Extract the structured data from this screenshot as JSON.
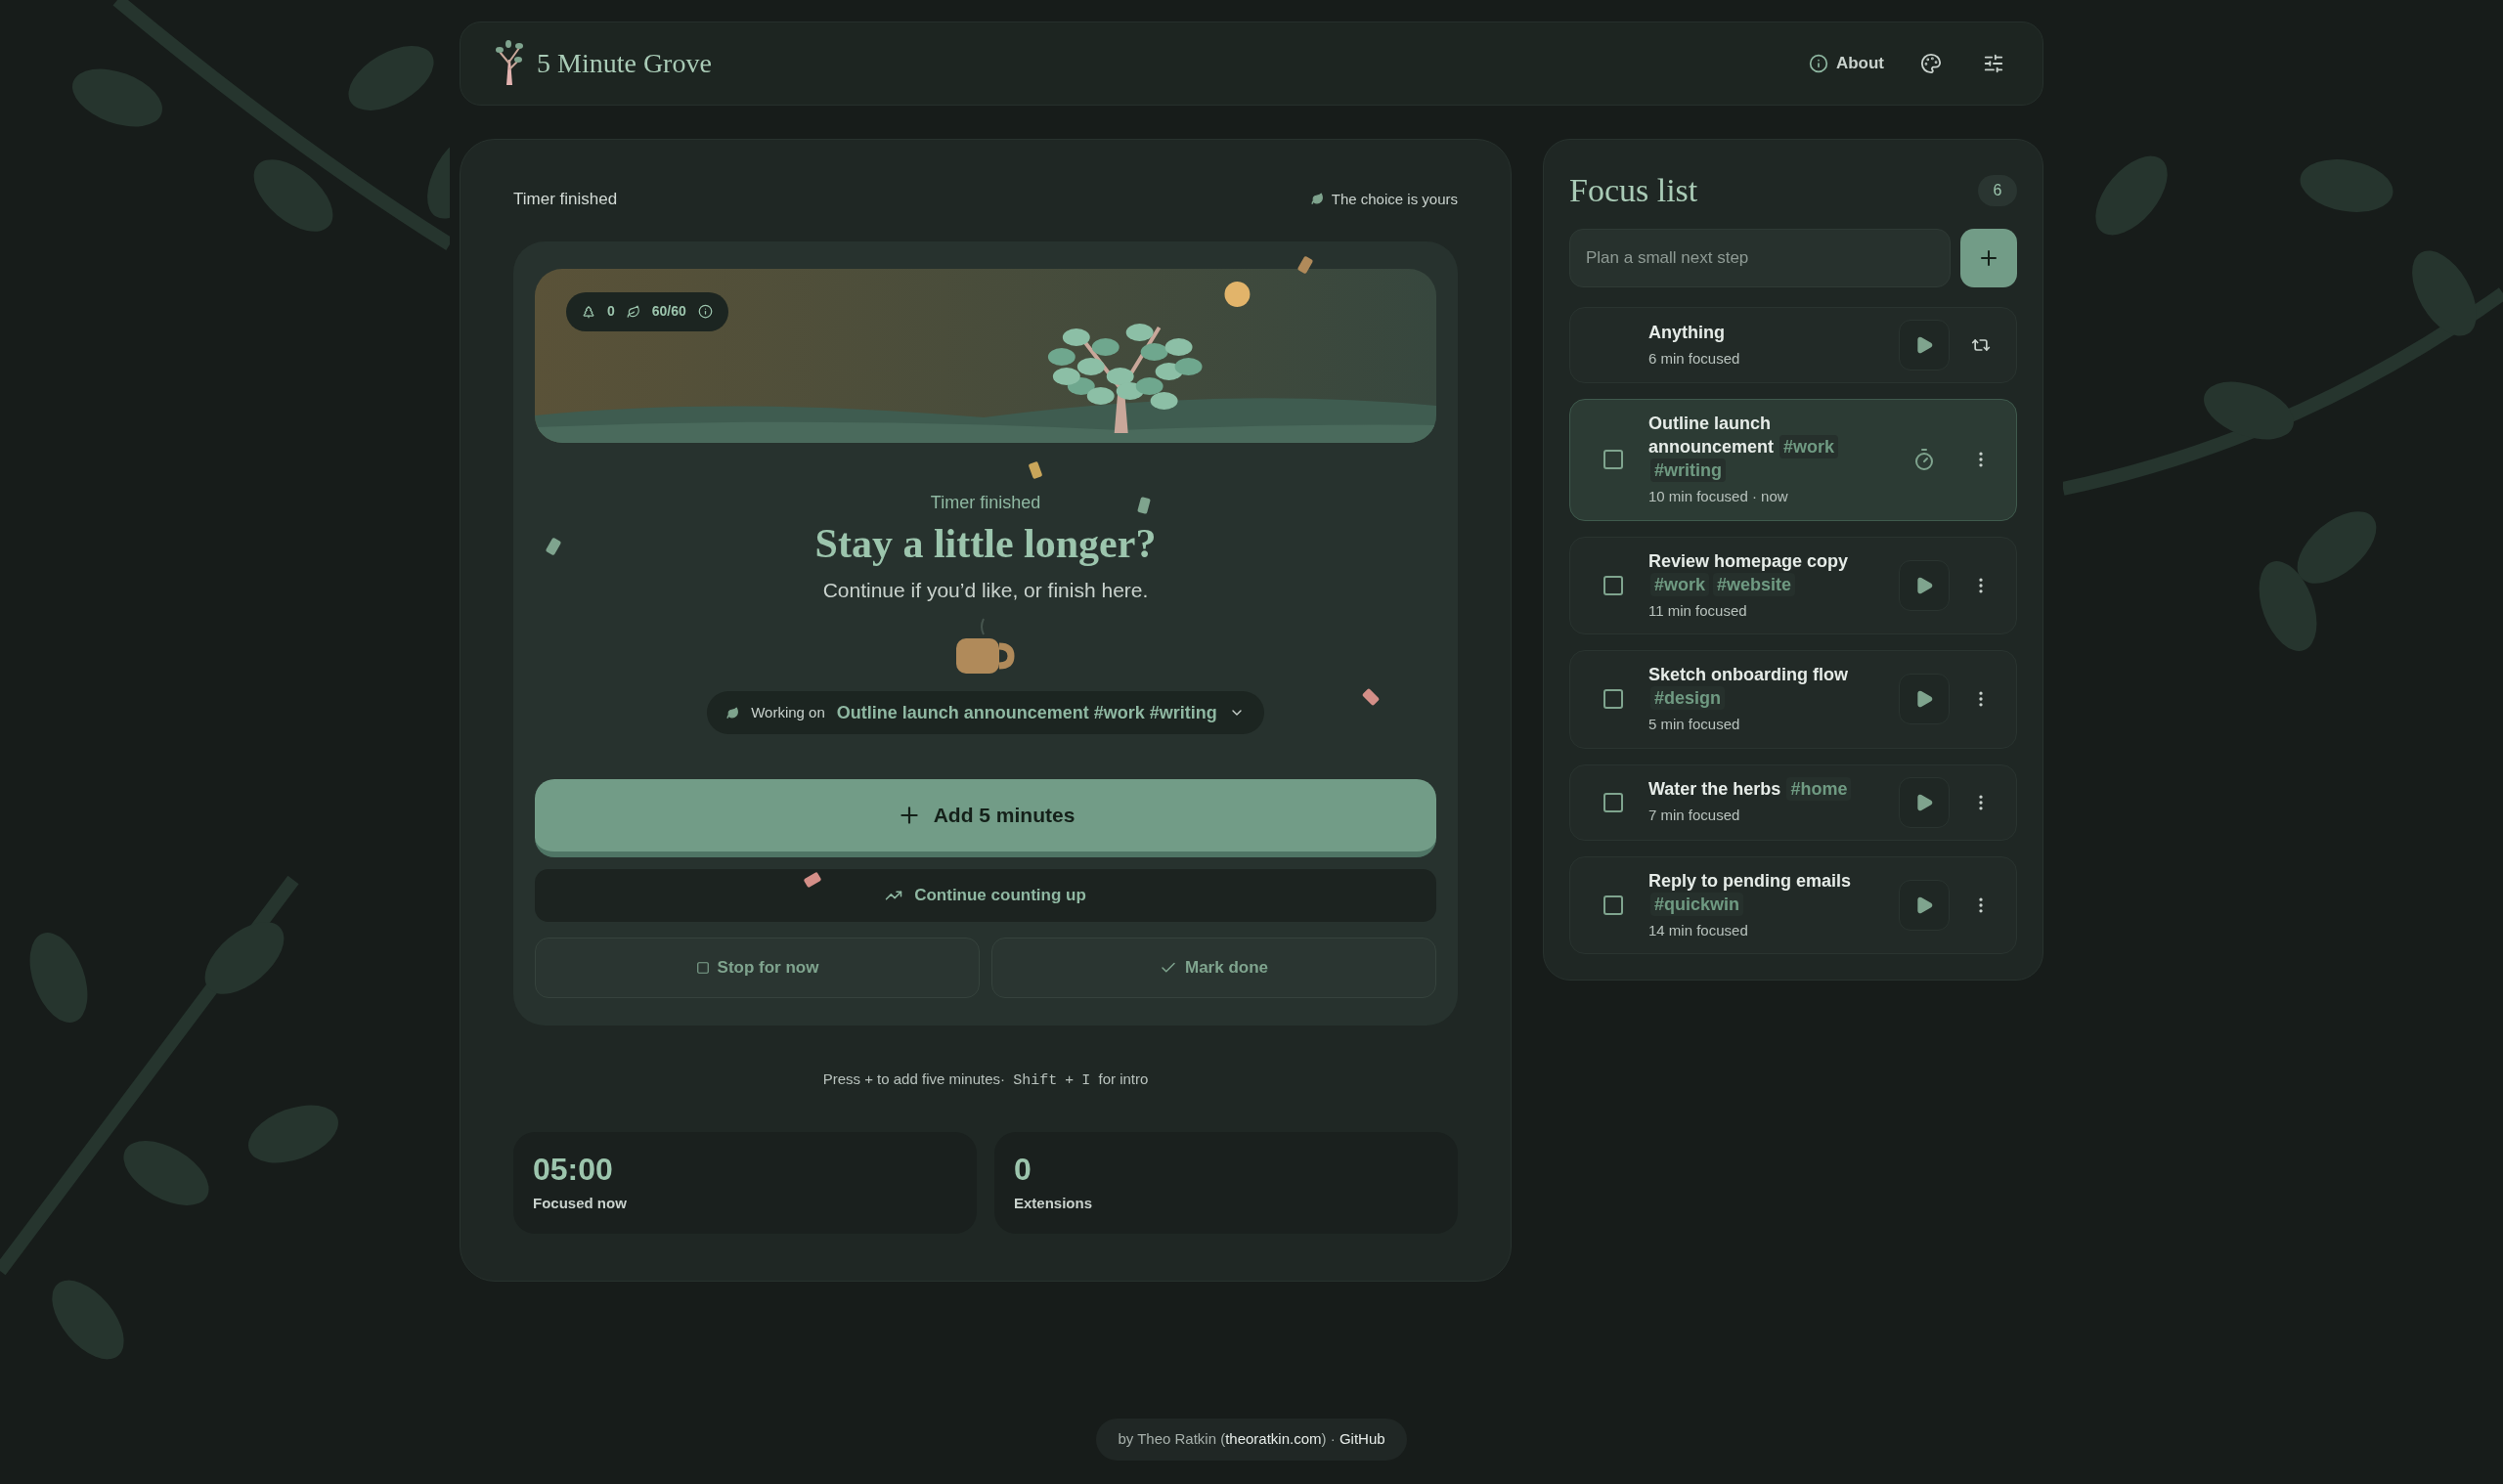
{
  "header": {
    "title": "5 Minute Grove",
    "about_label": "About"
  },
  "timer": {
    "status": "Timer finished",
    "choice_label": "The choice is yours",
    "scene": {
      "trees": "0",
      "leaves": "60/60"
    },
    "eyebrow": "Timer finished",
    "heading": "Stay a little longer?",
    "subtitle": "Continue if you’d like, or finish here.",
    "working_on": {
      "label": "Working on",
      "task": "Outline launch announcement #work #writing"
    },
    "primary_button": "Add 5 minutes",
    "secondary_button": "Continue counting up",
    "actions": [
      {
        "kind": "stop",
        "label": "Stop for now"
      },
      {
        "kind": "done",
        "label": "Mark done"
      }
    ],
    "hint": [
      {
        "kind": "text",
        "text": "Press + to add five minutes·"
      },
      {
        "kind": "key",
        "text": "Shift"
      },
      {
        "kind": "text",
        "text": "+"
      },
      {
        "kind": "key",
        "text": "I"
      },
      {
        "kind": "text",
        "text": "for intro"
      }
    ],
    "stats": [
      {
        "value": "05:00",
        "label": "Focused now"
      },
      {
        "value": "0",
        "label": "Extensions"
      }
    ]
  },
  "focus_list": {
    "title": "Focus list",
    "count": "6",
    "placeholder": "Plan a small next step",
    "tasks": [
      {
        "kind": "general",
        "title": "Anything",
        "meta": "6 min focused",
        "active": false
      },
      {
        "kind": "task",
        "title": "Outline launch announcement",
        "tags": [
          "#work",
          "#writing"
        ],
        "meta": "10 min focused · now",
        "active": true,
        "checked": false
      },
      {
        "kind": "task",
        "title": "Review homepage copy",
        "tags": [
          "#work",
          "#website"
        ],
        "meta": "11 min focused",
        "active": false,
        "checked": false
      },
      {
        "kind": "task",
        "title": "Sketch onboarding flow",
        "tags": [
          "#design"
        ],
        "meta": "5 min focused",
        "active": false,
        "checked": false
      },
      {
        "kind": "task",
        "title": "Water the herbs",
        "tags": [
          "#home"
        ],
        "meta": "7 min focused",
        "active": false,
        "checked": false
      },
      {
        "kind": "task",
        "title": "Reply to pending emails",
        "tags": [
          "#quickwin"
        ],
        "meta": "14 min focused",
        "active": false,
        "checked": false
      }
    ]
  },
  "footer": {
    "prefix": "by Theo Ratkin (",
    "site_link": "theoratkin.com",
    "separator": ") ·",
    "github_link": "GitHub"
  }
}
